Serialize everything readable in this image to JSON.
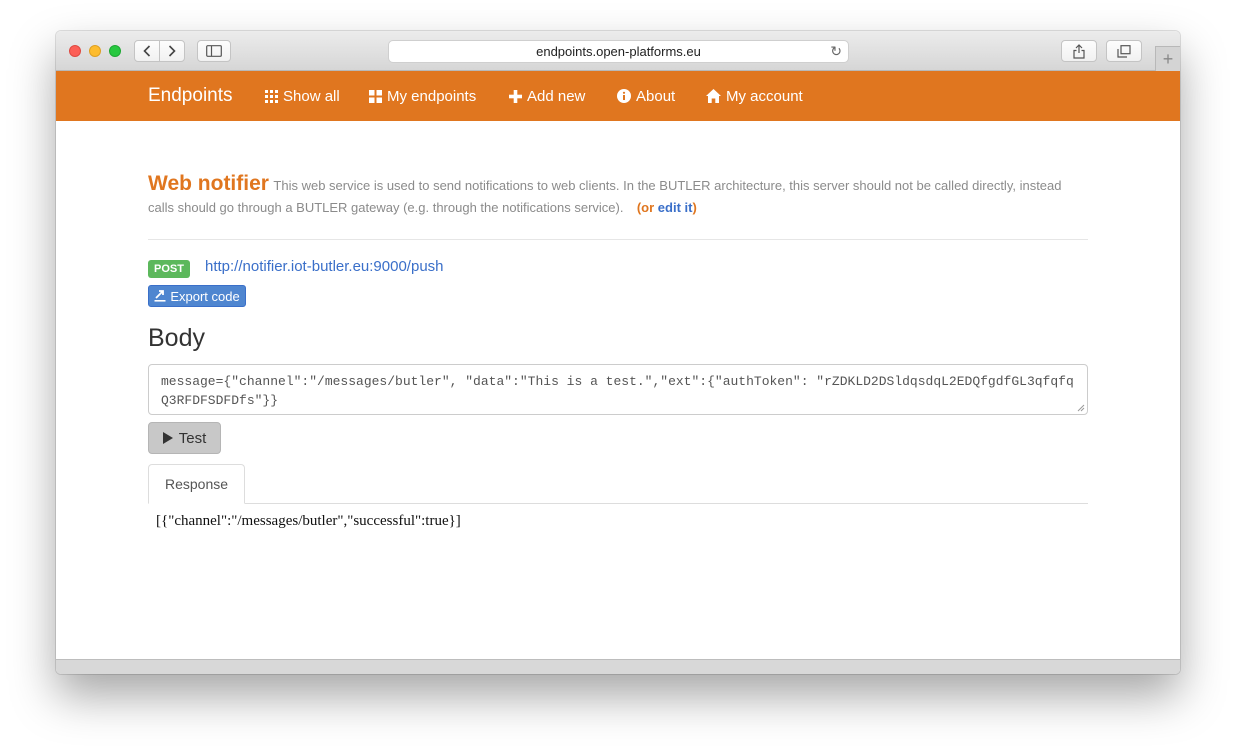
{
  "browser": {
    "url": "endpoints.open-platforms.eu",
    "newtab_label": "+"
  },
  "navbar": {
    "brand": "Endpoints",
    "items": [
      {
        "label": "Show all",
        "icon": "grid-icon"
      },
      {
        "label": "My endpoints",
        "icon": "tiles-icon"
      },
      {
        "label": "Add new",
        "icon": "plus-icon"
      },
      {
        "label": "About",
        "icon": "info-icon"
      },
      {
        "label": "My account",
        "icon": "home-icon"
      }
    ],
    "color": "#e0761f"
  },
  "endpoint": {
    "title": "Web notifier",
    "description": "This web service is used to send notifications to web clients. In the BUTLER architecture, this server should not be called directly, instead calls should go through a BUTLER gateway (e.g. through the notifications service).",
    "edit_prefix": "(or ",
    "edit_label": "edit it",
    "edit_suffix": ")",
    "method": "POST",
    "url": "http://notifier.iot-butler.eu:9000/push",
    "export_label": "Export code"
  },
  "body": {
    "heading": "Body",
    "value": "message={\"channel\":\"/messages/butler\", \"data\":\"This is a test.\",\"ext\":{\"authToken\": \"rZDKLD2DSldqsdqL2EDQfgdfGL3qfqfqQ3RFDFSDFDfs\"}}",
    "test_label": "Test"
  },
  "response": {
    "tab_label": "Response",
    "text": "[{\"channel\":\"/messages/butler\",\"successful\":true}]"
  }
}
